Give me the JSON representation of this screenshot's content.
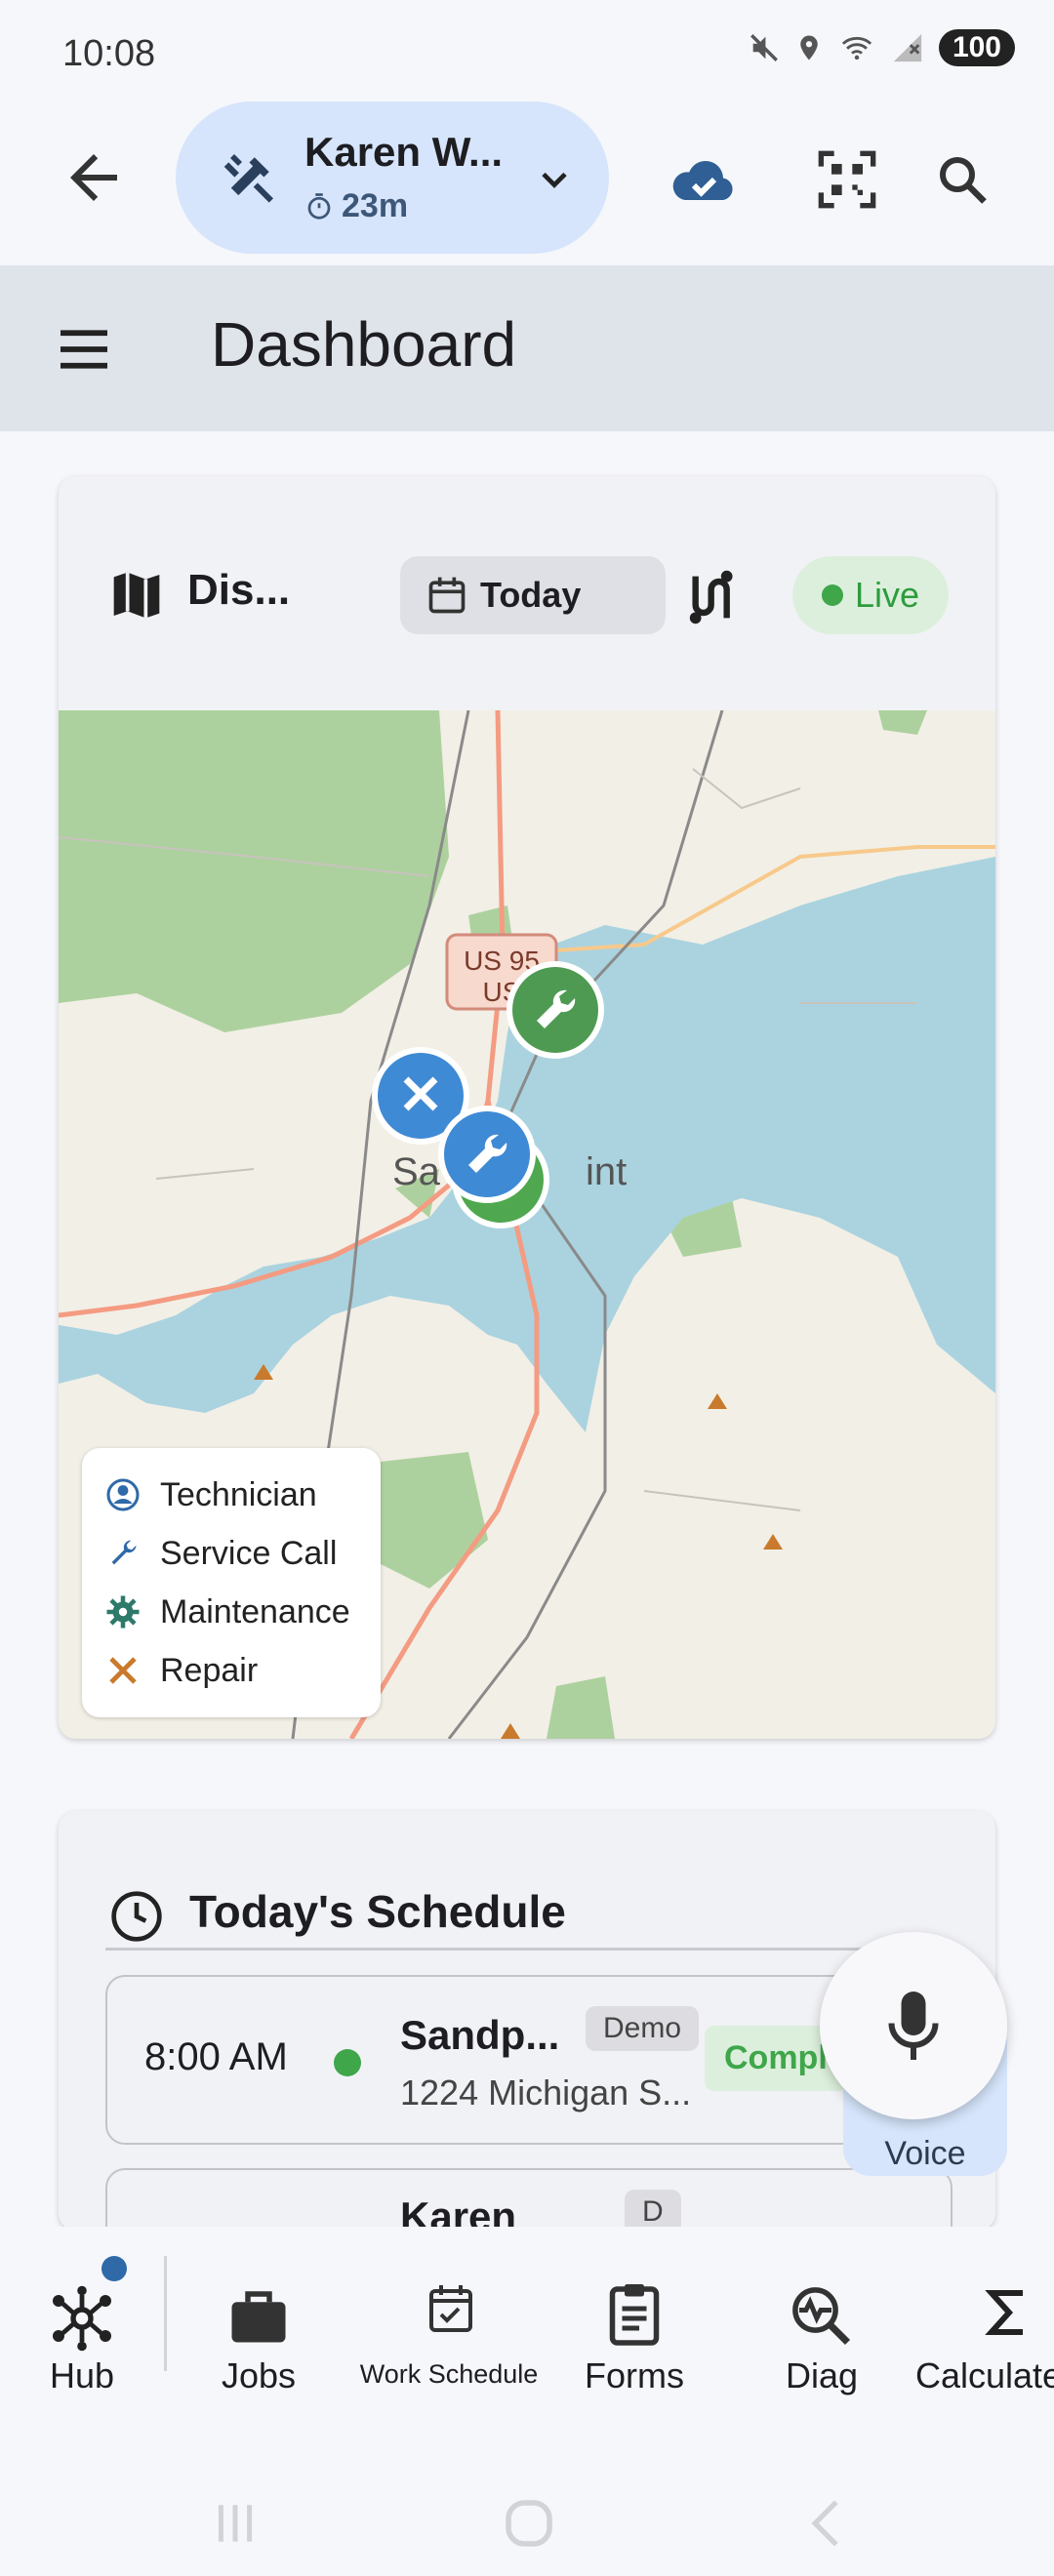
{
  "status_bar": {
    "time": "10:08",
    "battery": "100"
  },
  "header": {
    "user_name": "Karen W...",
    "user_timer": "23m"
  },
  "dashboard": {
    "title": "Dashboard"
  },
  "dispatch": {
    "title": "Dis...",
    "date_chip": "Today",
    "live_label": "Live",
    "map_labels": {
      "us95": "US 95",
      "us": "US",
      "city_left": "Sa",
      "city_right": "int"
    },
    "legend": [
      {
        "label": "Technician",
        "icon": "technician-icon"
      },
      {
        "label": "Service Call",
        "icon": "wrench-icon"
      },
      {
        "label": "Maintenance",
        "icon": "gear-icon"
      },
      {
        "label": "Repair",
        "icon": "hammer-wrench-icon"
      }
    ]
  },
  "schedule": {
    "title": "Today's Schedule",
    "rows": [
      {
        "time": "8:00 AM",
        "name": "Sandp...",
        "badge": "Demo",
        "address": "1224 Michigan S...",
        "status": "Compl"
      },
      {
        "name": "Karen",
        "badge": "D"
      }
    ]
  },
  "fab": {
    "label": "Voice"
  },
  "bottom_nav": [
    {
      "label": "Hub",
      "icon": "hub-icon"
    },
    {
      "label": "Jobs",
      "icon": "briefcase-icon"
    },
    {
      "label": "Work Schedule",
      "icon": "calendar-check-icon"
    },
    {
      "label": "Forms",
      "icon": "clipboard-icon"
    },
    {
      "label": "Diag",
      "icon": "diagnostic-icon"
    },
    {
      "label": "Calculate",
      "icon": "sigma-icon"
    }
  ],
  "colors": {
    "accent_blue": "#2f69a8",
    "chip_blue": "#d6e5fb",
    "live_green": "#3fa64a",
    "marker_blue": "#3f8ad4",
    "marker_green": "#4f9a52",
    "water": "#aad3df",
    "park": "#add19e",
    "road": "#f49b82"
  }
}
